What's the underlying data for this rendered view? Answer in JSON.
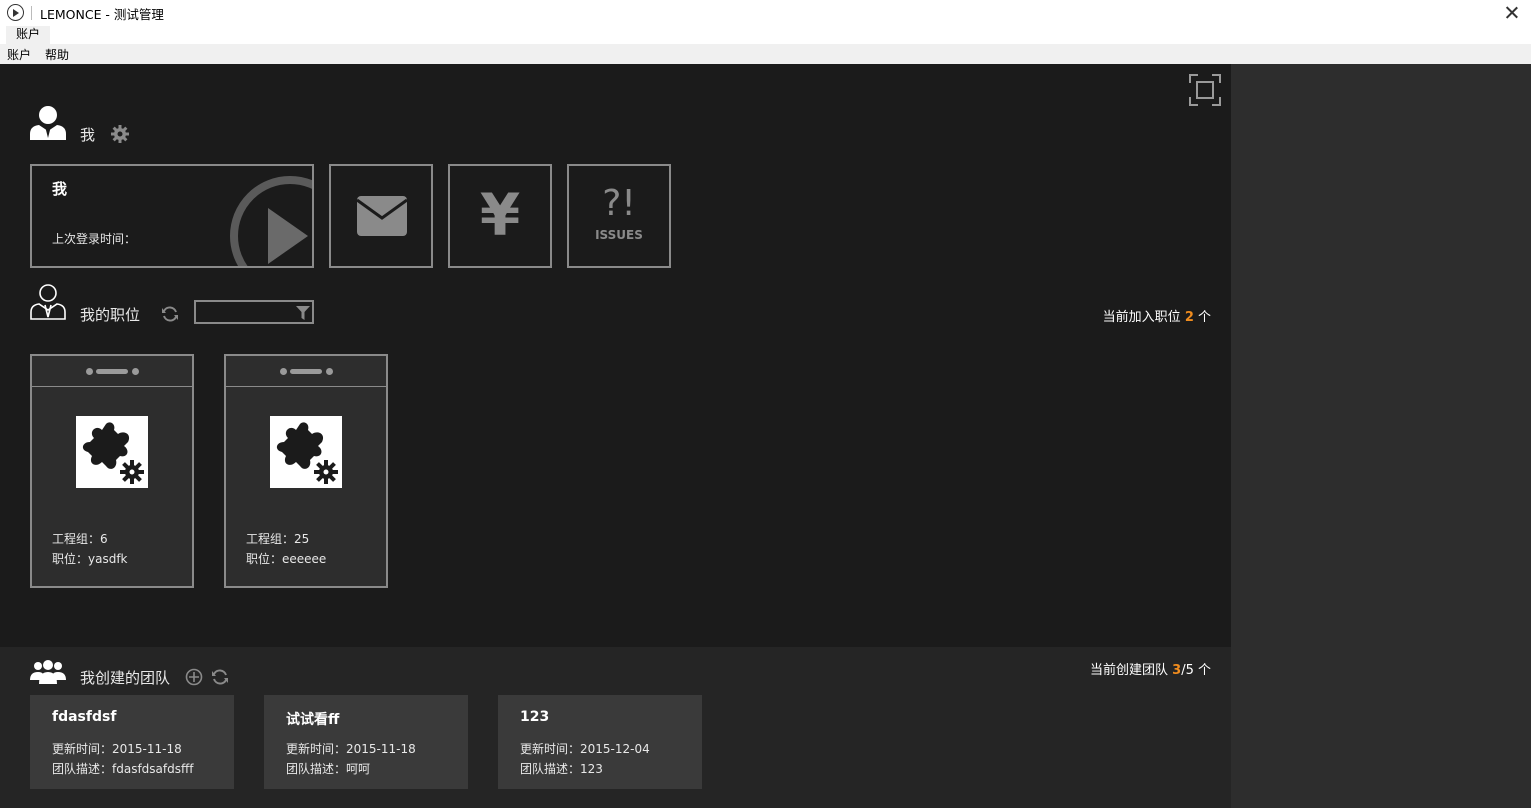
{
  "window": {
    "title": "LEMONCE - 测试管理"
  },
  "ribbon": {
    "active_tab": "账户"
  },
  "menu": {
    "items": [
      "账户",
      "帮助"
    ]
  },
  "me": {
    "section_label": "我",
    "profile_name": "我",
    "last_login_label": "上次登录时间：",
    "issues_label": "ISSUES",
    "issues_glyph": "?!",
    "yen_glyph": "¥"
  },
  "positions": {
    "section_label": "我的职位",
    "search_placeholder": "",
    "stat_prefix": "当前加入职位 ",
    "stat_count": "2",
    "stat_suffix": " 个",
    "cards": [
      {
        "group": "工程组：6",
        "position": "职位：yasdfk"
      },
      {
        "group": "工程组：25",
        "position": "职位：eeeeee"
      }
    ]
  },
  "teams": {
    "section_label": "我创建的团队",
    "stat_prefix": "当前创建团队 ",
    "stat_count": "3",
    "stat_suffix": "/5 个",
    "cards": [
      {
        "name": "fdasfdsf",
        "updated": "更新时间：2015-11-18",
        "desc": "团队描述：fdasfdsafdsfff"
      },
      {
        "name": "试试看ff",
        "updated": "更新时间：2015-11-18",
        "desc": "团队描述：呵呵"
      },
      {
        "name": "123",
        "updated": "更新时间：2015-12-04",
        "desc": "团队描述：123"
      }
    ]
  },
  "colors": {
    "accent": "#f08c1e",
    "background": "#1b1b1b",
    "tile_border": "#8a8a8a"
  }
}
